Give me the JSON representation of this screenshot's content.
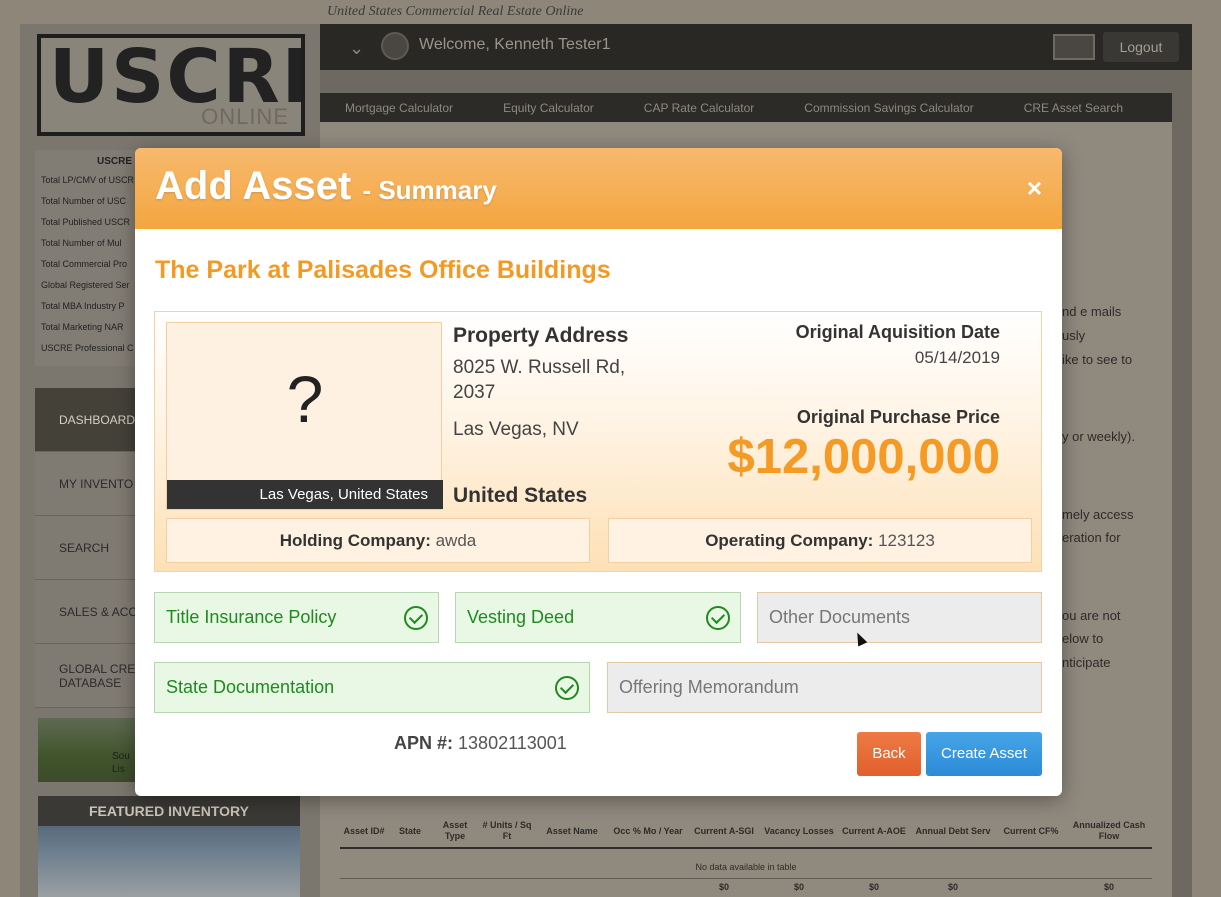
{
  "app": {
    "tagline": "United States Commercial Real Estate Online",
    "logo_main": "USCRE",
    "logo_sub": "ONLINE"
  },
  "header": {
    "welcome": "Welcome, Kenneth Tester1",
    "logout_label": "Logout"
  },
  "top_nav": [
    "Mortgage Calculator",
    "Equity Calculator",
    "CAP Rate Calculator",
    "Commission Savings Calculator",
    "CRE Asset Search"
  ],
  "stats": {
    "title": "USCRE D",
    "items": [
      "Total LP/CMV of USCR",
      "Total Number of USC",
      "Total Published USCR",
      "Total Number of Mul",
      "Total Commercial Pro",
      "Global Registered Ser",
      "Total MBA Industry P",
      "Total Marketing NAR",
      "USCRE Professional C"
    ]
  },
  "side_nav": [
    "DASHBOARD",
    "MY INVENTO",
    "SEARCH",
    "SALES & ACC",
    "GLOBAL CRE\nDATABASE"
  ],
  "promo_text": "Sou\nLis",
  "featured_label": "FEATURED INVENTORY",
  "bg_snippets": [
    "nd e mails",
    "usly",
    "ike to see to",
    "y or weekly).",
    "mely access",
    "eration for",
    "ou are not",
    "elow to",
    "nticipate"
  ],
  "bg_table": {
    "headers": [
      "Asset ID#",
      "State",
      "Asset Type",
      "# Units / Sq Ft",
      "Asset Name",
      "Occ % Mo / Year",
      "Current A-SGI",
      "Vacancy Losses",
      "Current A-AOE",
      "Annual Debt Serv",
      "Current CF%",
      "Annualized Cash Flow"
    ],
    "empty_text": "No data available in table",
    "totals": [
      "",
      "",
      "",
      "",
      "",
      "",
      "$0",
      "$0",
      "$0",
      "$0",
      "",
      "$0"
    ]
  },
  "modal": {
    "title": "Add Asset",
    "subtitle": "- Summary",
    "close_label": "×",
    "property_name": "The Park at Palisades Office Buildings",
    "photo_placeholder": "?",
    "photo_caption": "Las Vegas, United States",
    "address_label": "Property Address",
    "address_line": "8025 W. Russell Rd, 2037",
    "city_state": "Las Vegas, NV",
    "country": "United States",
    "acq_label": "Original Aquisition Date",
    "acq_date": "05/14/2019",
    "price_label": "Original Purchase Price",
    "price": "$12,000,000",
    "holding_label": "Holding Company:",
    "holding_value": "awda",
    "operating_label": "Operating Company:",
    "operating_value": "123123",
    "documents": {
      "title_insurance": "Title Insurance Policy",
      "vesting_deed": "Vesting Deed",
      "other_docs": "Other Documents",
      "state_doc": "State Documentation",
      "offering_memo": "Offering Memorandum"
    },
    "apn_label": "APN #:",
    "apn_value": "13802113001",
    "back_label": "Back",
    "create_label": "Create Asset"
  }
}
